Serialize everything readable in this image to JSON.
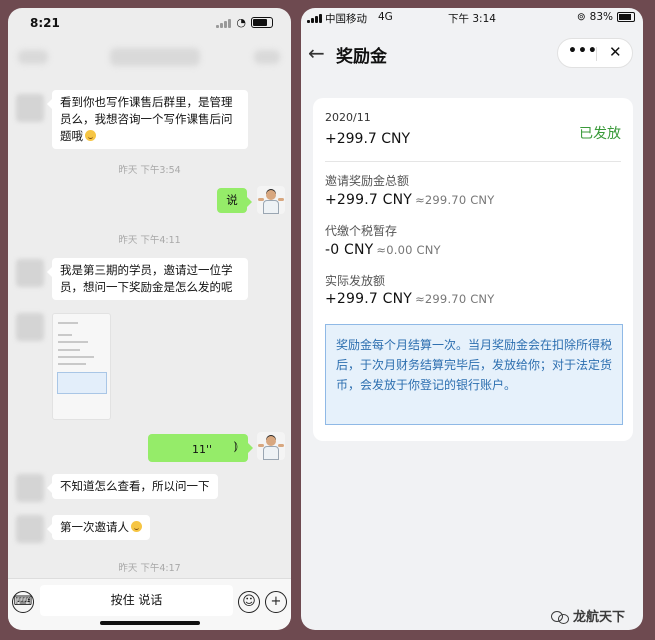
{
  "chat": {
    "status_time": "8:21",
    "messages": {
      "m1": "看到你也写作课售后群里，是管理员么，我想咨询一个写作课售后问题哦",
      "ts1": "昨天 下午3:54",
      "m2": "说",
      "ts2": "昨天 下午4:11",
      "m3": "我是第三期的学员，邀请过一位学员，想问一下奖励金是怎么发的呢",
      "voice_length": "11''",
      "m4": "不知道怎么查看，所以问一下",
      "m5": "第一次邀请人",
      "ts3": "昨天 下午4:17"
    },
    "input": {
      "hold_to_talk": "按住 说话"
    }
  },
  "reward": {
    "status_bar": {
      "carrier": "中国移动",
      "network": "4G",
      "time": "下午 3:14",
      "battery": "83%"
    },
    "title": "奖励金",
    "capsule": {
      "more": "•••",
      "close": "✕"
    },
    "period": "2020/11",
    "total": "+299.7 CNY",
    "status": "已发放",
    "rows": [
      {
        "label": "邀请奖励金总额",
        "amount": "+299.7 CNY",
        "approx": "≈299.70 CNY"
      },
      {
        "label": "代缴个税暂存",
        "amount": "-0 CNY",
        "approx": "≈0.00 CNY"
      },
      {
        "label": "实际发放额",
        "amount": "+299.7 CNY",
        "approx": "≈299.70 CNY"
      }
    ],
    "notice": "奖励金每个月结算一次。当月奖励金会在扣除所得税后，于次月财务结算完毕后，发放给你；对于法定货币，会发放于你登记的银行账户。"
  },
  "watermark": "龙航天下"
}
